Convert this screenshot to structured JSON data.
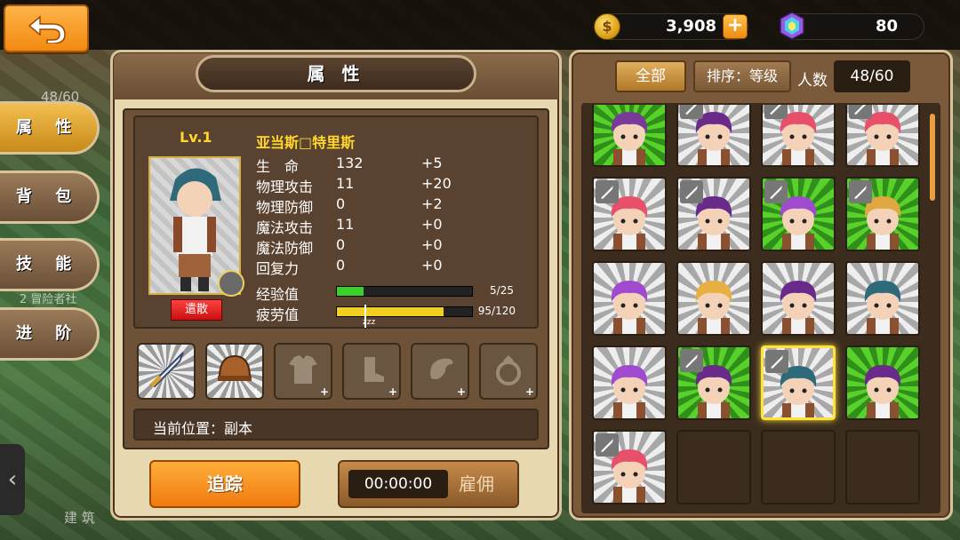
{
  "background": {
    "top_left_text": "48/60",
    "side_text_1": "2 冒险者社",
    "bottom_text": "建 筑"
  },
  "top": {
    "gold": "3,908",
    "gold_icon": "gold-coin-icon",
    "gold_add": "+",
    "gems": "80",
    "gem_icon": "rainbow-gem-icon"
  },
  "left_panel": {
    "title": "属 性"
  },
  "tabs": [
    {
      "label": "属 性",
      "active": true
    },
    {
      "label": "背 包",
      "active": false
    },
    {
      "label": "技 能",
      "active": false
    },
    {
      "label": "进 阶",
      "active": false
    }
  ],
  "hero": {
    "level": "Lv.1",
    "name": "亚当斯□特里斯",
    "dismiss": "遣散",
    "stats": [
      {
        "label": "生　命",
        "value": "132",
        "bonus": "+5"
      },
      {
        "label": "物理攻击",
        "value": "11",
        "bonus": "+20"
      },
      {
        "label": "物理防御",
        "value": "0",
        "bonus": "+2"
      },
      {
        "label": "魔法攻击",
        "value": "11",
        "bonus": "+0"
      },
      {
        "label": "魔法防御",
        "value": "0",
        "bonus": "+0"
      },
      {
        "label": "回复力",
        "value": "0",
        "bonus": "+0"
      }
    ],
    "exp": {
      "label": "经验值",
      "text": "5/25",
      "fraction": 0.2
    },
    "fatigue": {
      "label": "疲劳值",
      "text": "95/120",
      "fraction": 0.79,
      "marker": "zzz"
    },
    "location": "当前位置：副本"
  },
  "equipment": [
    {
      "name": "sword",
      "filled": true
    },
    {
      "name": "helmet",
      "filled": true
    },
    {
      "name": "armor",
      "filled": false
    },
    {
      "name": "boots",
      "filled": false
    },
    {
      "name": "cape",
      "filled": false
    },
    {
      "name": "ring",
      "filled": false
    }
  ],
  "buttons": {
    "track": "追踪",
    "timer": "00:00:00",
    "hire": "雇佣"
  },
  "right_panel": {
    "filter_all": "全部",
    "sort": "排序：等级",
    "count_label": "人数",
    "count": "48/60"
  },
  "heroes": [
    {
      "bg": "green",
      "hair": "#7a3a9a",
      "skin": "#f4d2b8",
      "sword": false,
      "sel": false
    },
    {
      "bg": "gray",
      "hair": "#6a2a8a",
      "skin": "#f4d2b8",
      "sword": true,
      "sel": false
    },
    {
      "bg": "gray",
      "hair": "#e8506a",
      "skin": "#f4d2b8",
      "sword": true,
      "sel": false
    },
    {
      "bg": "gray",
      "hair": "#e8506a",
      "skin": "#f4d2b8",
      "sword": true,
      "sel": false
    },
    {
      "bg": "gray",
      "hair": "#e8506a",
      "skin": "#f4d2b8",
      "sword": true,
      "sel": false
    },
    {
      "bg": "gray",
      "hair": "#6a2a8a",
      "skin": "#f4d2b8",
      "sword": true,
      "sel": false
    },
    {
      "bg": "green",
      "hair": "#a04ad0",
      "skin": "#f4d2b8",
      "sword": true,
      "sel": false
    },
    {
      "bg": "green",
      "hair": "#e0a840",
      "skin": "#f4d2b8",
      "sword": true,
      "sel": false
    },
    {
      "bg": "gray",
      "hair": "#a04ad0",
      "skin": "#f4d2b8",
      "sword": false,
      "sel": false
    },
    {
      "bg": "gray",
      "hair": "#e8b040",
      "skin": "#f4d2b8",
      "sword": false,
      "sel": false
    },
    {
      "bg": "gray",
      "hair": "#6a2a8a",
      "skin": "#f4d2b8",
      "sword": false,
      "sel": false
    },
    {
      "bg": "gray",
      "hair": "#2e6a7a",
      "skin": "#f4d2b8",
      "sword": false,
      "sel": false
    },
    {
      "bg": "gray",
      "hair": "#a04ad0",
      "skin": "#f4d2b8",
      "sword": false,
      "sel": false
    },
    {
      "bg": "green",
      "hair": "#6a2a8a",
      "skin": "#f4d2b8",
      "sword": true,
      "sel": false
    },
    {
      "bg": "gray",
      "hair": "#2e6a7a",
      "skin": "#f4d2b8",
      "sword": true,
      "sel": true
    },
    {
      "bg": "green",
      "hair": "#6a2a8a",
      "skin": "#f4d2b8",
      "sword": false,
      "sel": false
    },
    {
      "bg": "gray",
      "hair": "#e8506a",
      "skin": "#f4d2b8",
      "sword": true,
      "sel": false
    },
    {
      "bg": "empty"
    },
    {
      "bg": "empty"
    },
    {
      "bg": "empty"
    }
  ]
}
